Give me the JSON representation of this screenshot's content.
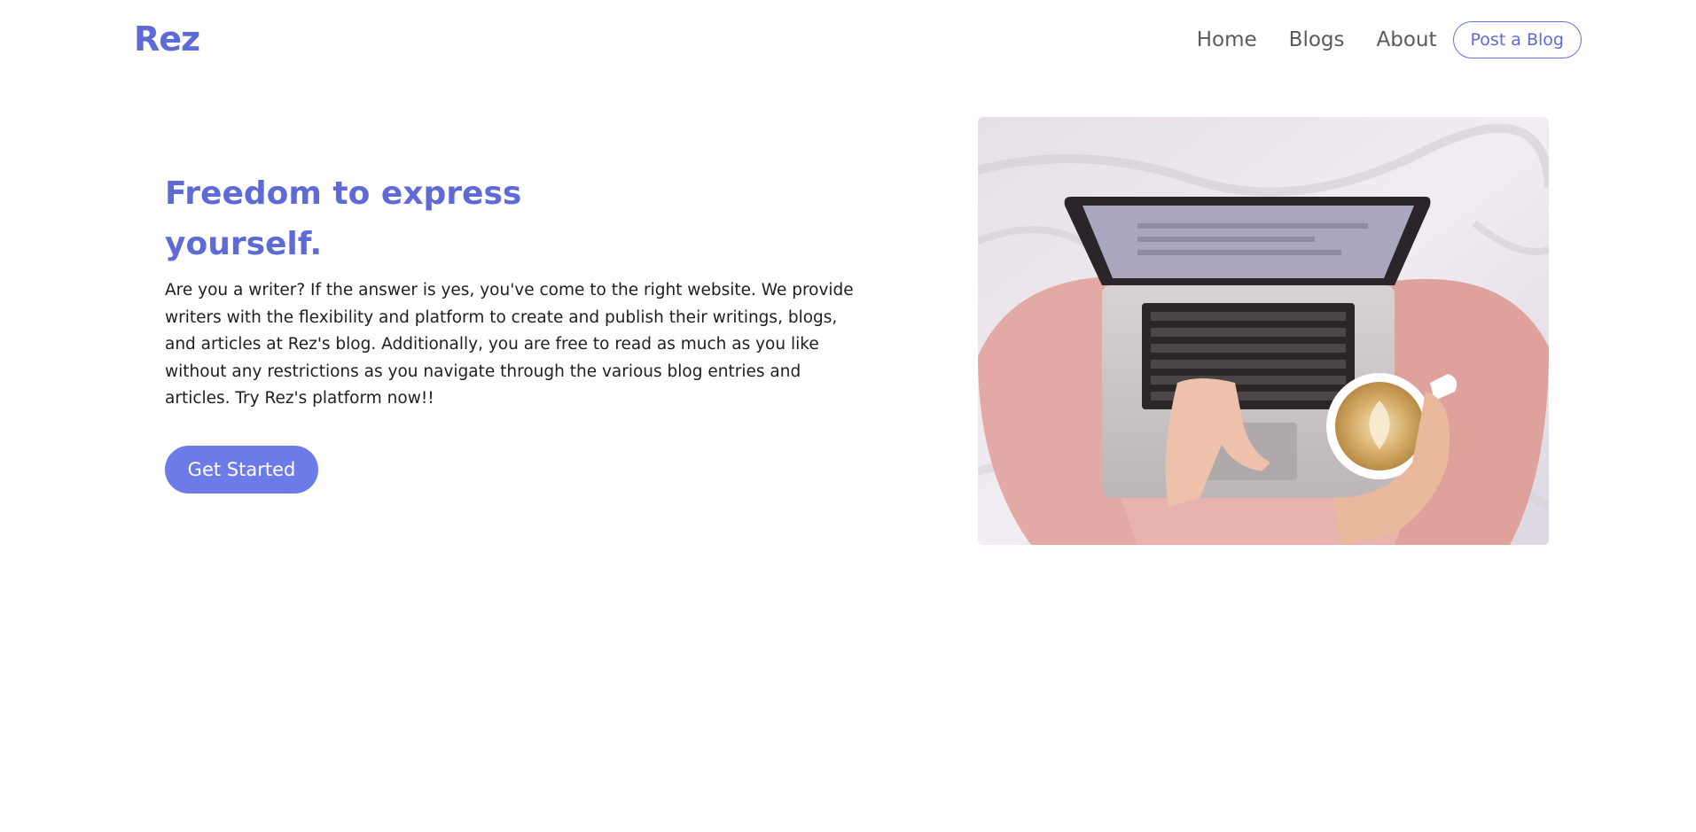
{
  "header": {
    "logo": "Rez",
    "nav": {
      "home": "Home",
      "blogs": "Blogs",
      "about": "About",
      "post_blog": "Post a Blog"
    }
  },
  "hero": {
    "title": "Freedom to express yourself.",
    "description": "Are you a writer? If the answer is yes, you've come to the right website. We provide writers with the flexibility and platform to create and publish their writings, blogs, and articles at Rez's blog. Additionally, you are free to read as much as you like without any restrictions as you navigate through the various blog entries and articles. Try Rez's platform now!!",
    "cta_label": "Get Started",
    "image_subject": "laptop-on-bed-with-coffee-photo"
  },
  "colors": {
    "brand": "#5e6ad6",
    "cta_background": "#6d7be8",
    "nav_text": "#5b5b5b",
    "body_text": "#1e1e1e"
  }
}
